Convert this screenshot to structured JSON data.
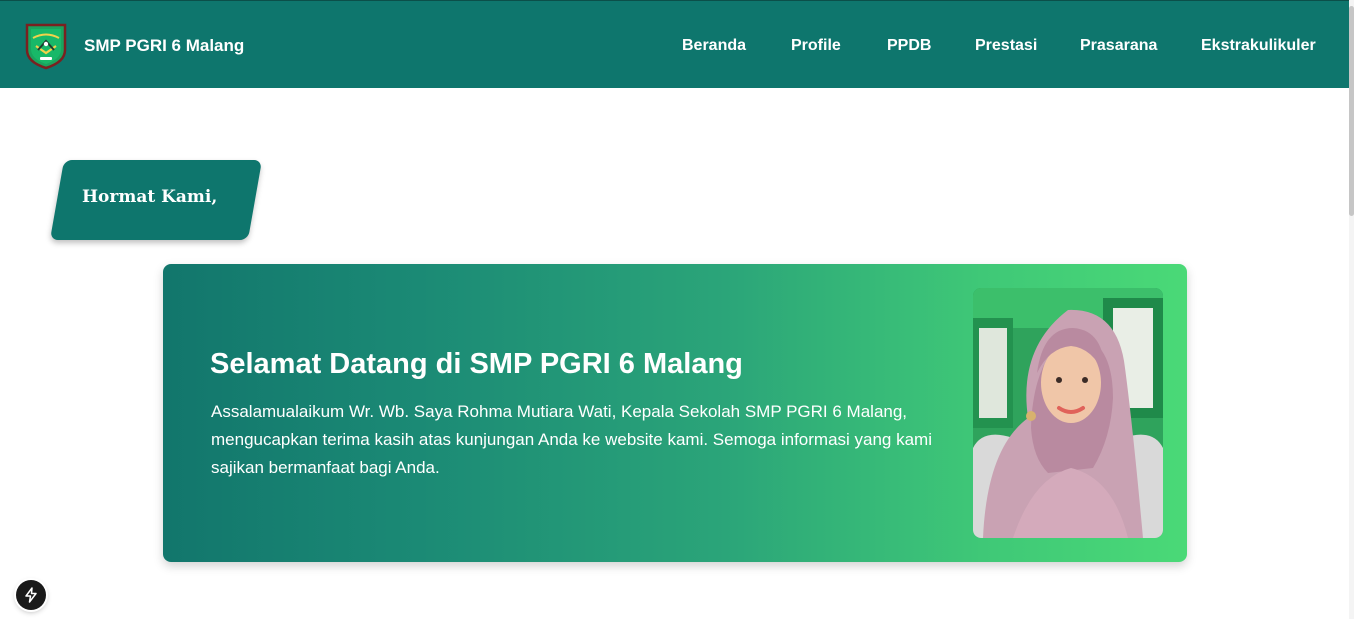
{
  "header": {
    "brand": "SMP PGRI 6 Malang",
    "logo_icon": "school-crest-icon",
    "nav": [
      {
        "label": "Beranda"
      },
      {
        "label": "Profile"
      },
      {
        "label": "PPDB"
      },
      {
        "label": "Prestasi"
      },
      {
        "label": "Prasarana"
      },
      {
        "label": "Ekstrakulikuler"
      }
    ]
  },
  "section_badge": "Hormat Kami,",
  "welcome": {
    "title": "Selamat Datang di SMP PGRI 6 Malang",
    "body": "Assalamualaikum Wr. Wb. Saya Rohma Mutiara Wati, Kepala Sekolah SMP PGRI 6 Malang, mengucapkan terima kasih atas kunjungan Anda ke website kami. Semoga informasi yang kami sajikan bermanfaat bagi Anda."
  },
  "colors": {
    "primary": "#0e766d",
    "gradient_start": "#12766c",
    "gradient_end": "#4ad977"
  },
  "floating_button_icon": "lightning-bolt-icon"
}
